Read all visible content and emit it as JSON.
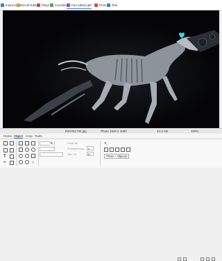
{
  "tabs": [
    {
      "label": "Instructions",
      "color": "#3b7ddd",
      "selected": false
    },
    {
      "label": "Scroll Editor",
      "color": "#d9a23b",
      "selected": false
    },
    {
      "label": "Plays",
      "color": "#d04a4a",
      "selected": false
    },
    {
      "label": "Caroline",
      "color": "#5aa05a",
      "selected": false
    },
    {
      "label": "Fan-edited gift",
      "color": "#7a5ad0",
      "selected": true
    },
    {
      "label": "Prod",
      "color": "#d04a4a",
      "selected": false
    },
    {
      "label": "Tele",
      "color": "#3b7ddd",
      "selected": false
    }
  ],
  "status": {
    "filename": "IMG051792.jpg",
    "dimensions": "Photo 1920 x 1080",
    "filesize": "24.4 KB",
    "zoom": "100%"
  },
  "ribbon_tabs": [
    "Home",
    "Object",
    "Crop",
    "Tools"
  ],
  "ribbon": {
    "color_label": "Color fill",
    "transparency_label": "Transparency",
    "transparency_value": "0",
    "size_label": "Size 10",
    "size_value": "10",
    "photo_objects_button": "Photo + Objects"
  },
  "canvas": {
    "background": "#050507",
    "accent_heart": "#2fd6ff"
  }
}
